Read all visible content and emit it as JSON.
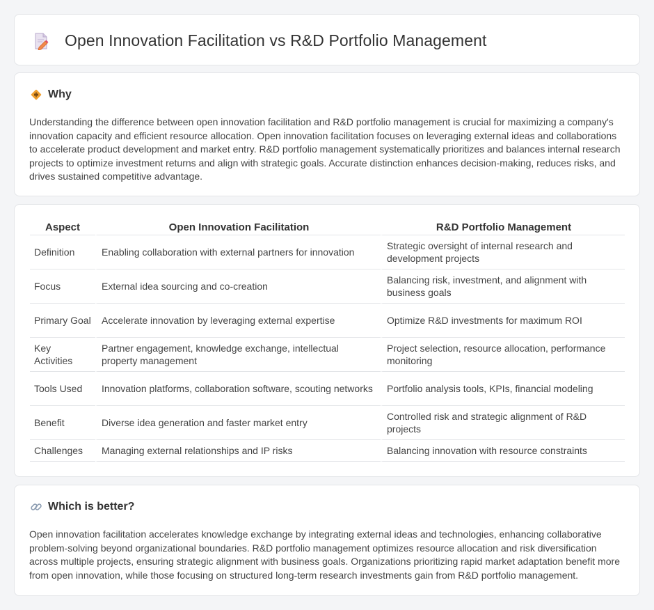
{
  "header": {
    "title": "Open Innovation Facilitation vs R&D Portfolio Management",
    "icon": "document-pencil-icon"
  },
  "why": {
    "title": "Why",
    "icon": "diamond-sign-icon",
    "text": "Understanding the difference between open innovation facilitation and R&D portfolio management is crucial for maximizing a company's innovation capacity and efficient resource allocation. Open innovation facilitation focuses on leveraging external ideas and collaborations to accelerate product development and market entry. R&D portfolio management systematically prioritizes and balances internal research projects to optimize investment returns and align with strategic goals. Accurate distinction enhances decision-making, reduces risks, and drives sustained competitive advantage."
  },
  "table": {
    "headers": [
      "Aspect",
      "Open Innovation Facilitation",
      "R&D Portfolio Management"
    ],
    "rows": [
      [
        "Definition",
        "Enabling collaboration with external partners for innovation",
        "Strategic oversight of internal research and development projects"
      ],
      [
        "Focus",
        "External idea sourcing and co-creation",
        "Balancing risk, investment, and alignment with business goals"
      ],
      [
        "Primary Goal",
        "Accelerate innovation by leveraging external expertise",
        "Optimize R&D investments for maximum ROI"
      ],
      [
        "Key Activities",
        "Partner engagement, knowledge exchange, intellectual property management",
        "Project selection, resource allocation, performance monitoring"
      ],
      [
        "Tools Used",
        "Innovation platforms, collaboration software, scouting networks",
        "Portfolio analysis tools, KPIs, financial modeling"
      ],
      [
        "Benefit",
        "Diverse idea generation and faster market entry",
        "Controlled risk and strategic alignment of R&D projects"
      ],
      [
        "Challenges",
        "Managing external relationships and IP risks",
        "Balancing innovation with resource constraints"
      ]
    ]
  },
  "better": {
    "title": "Which is better?",
    "icon": "link-icon",
    "text": "Open innovation facilitation accelerates knowledge exchange by integrating external ideas and technologies, enhancing collaborative problem-solving beyond organizational boundaries. R&D portfolio management optimizes resource allocation and risk diversification across multiple projects, ensuring strategic alignment with business goals. Organizations prioritizing rapid market adaptation benefit more from open innovation, while those focusing on structured long-term research investments gain from R&D portfolio management."
  },
  "colors": {
    "background": "#f4f5f7",
    "card": "#ffffff",
    "border": "#e3e5e8",
    "accent": "#f0a030"
  }
}
